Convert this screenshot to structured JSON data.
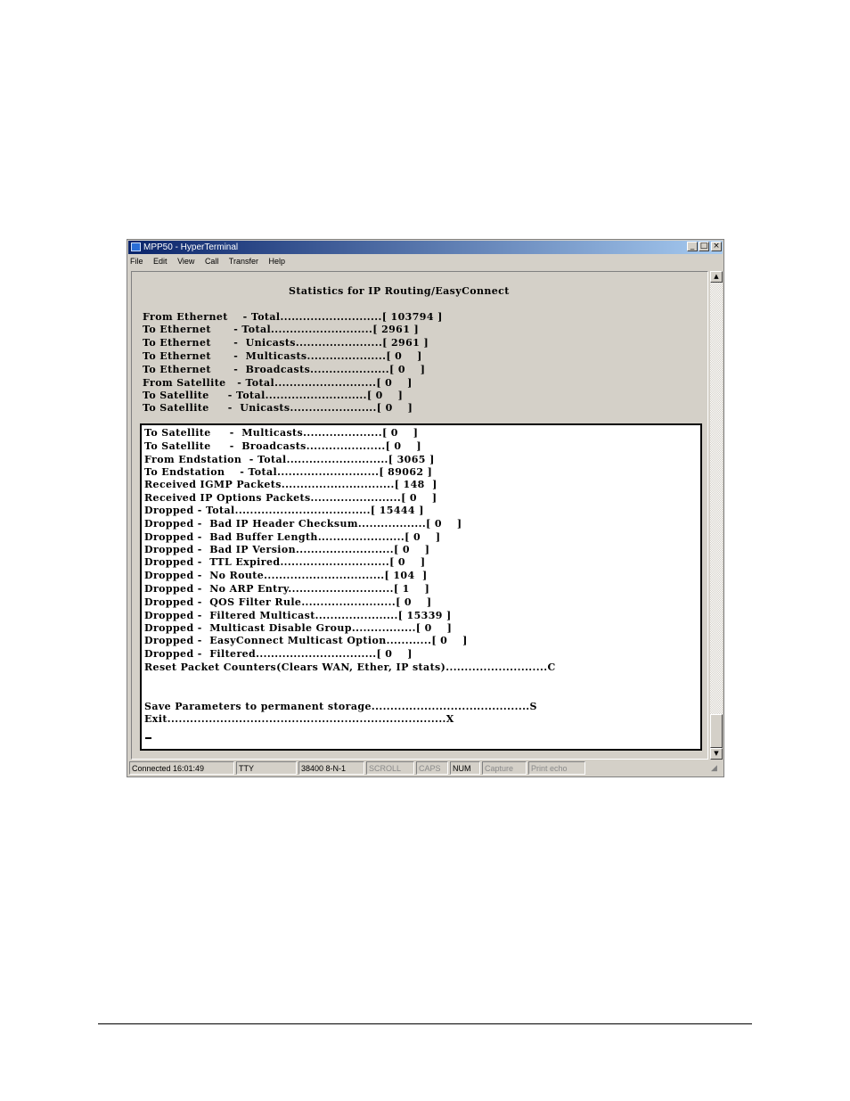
{
  "window": {
    "title": "MPP50 - HyperTerminal",
    "minimize_glyph": "_",
    "maximize_glyph": "□",
    "close_glyph": "×"
  },
  "menu": [
    "File",
    "Edit",
    "View",
    "Call",
    "Transfer",
    "Help"
  ],
  "terminal": {
    "heading": "Statistics for IP Routing/EasyConnect",
    "upper_lines": [
      "From Ethernet    - Total...........................[ 103794 ]",
      "To Ethernet      - Total...........................[ 2961 ]",
      "To Ethernet      -  Unicasts.......................[ 2961 ]",
      "To Ethernet      -  Multicasts.....................[ 0    ]",
      "To Ethernet      -  Broadcasts.....................[ 0    ]",
      "From Satellite   - Total...........................[ 0    ]",
      "To Satellite     - Total...........................[ 0    ]",
      "To Satellite     -  Unicasts.......................[ 0    ]"
    ],
    "lower_lines": [
      "To Satellite     -  Multicasts.....................[ 0    ]",
      "To Satellite     -  Broadcasts.....................[ 0    ]",
      "From Endstation  - Total...........................[ 3065 ]",
      "To Endstation    - Total...........................[ 89062 ]",
      "Received IGMP Packets..............................[ 148  ]",
      "Received IP Options Packets........................[ 0    ]",
      "Dropped - Total....................................[ 15444 ]",
      "Dropped -  Bad IP Header Checksum..................[ 0    ]",
      "Dropped -  Bad Buffer Length.......................[ 0    ]",
      "Dropped -  Bad IP Version..........................[ 0    ]",
      "Dropped -  TTL Expired.............................[ 0    ]",
      "Dropped -  No Route................................[ 104  ]",
      "Dropped -  No ARP Entry............................[ 1    ]",
      "Dropped -  QOS Filter Rule.........................[ 0    ]",
      "Dropped -  Filtered Multicast......................[ 15339 ]",
      "Dropped -  Multicast Disable Group.................[ 0    ]",
      "Dropped -  EasyConnect Multicast Option............[ 0    ]",
      "Dropped -  Filtered................................[ 0    ]",
      "Reset Packet Counters(Clears WAN, Ether, IP stats)...........................C"
    ],
    "save_line": "Save Parameters to permanent storage..........................................S",
    "exit_line": "Exit..........................................................................X"
  },
  "status": {
    "connected": "Connected 16:01:49",
    "emulation": "TTY",
    "port_settings": "38400 8-N-1",
    "scroll": "SCROLL",
    "caps": "CAPS",
    "num": "NUM",
    "capture": "Capture",
    "print_echo": "Print echo"
  }
}
